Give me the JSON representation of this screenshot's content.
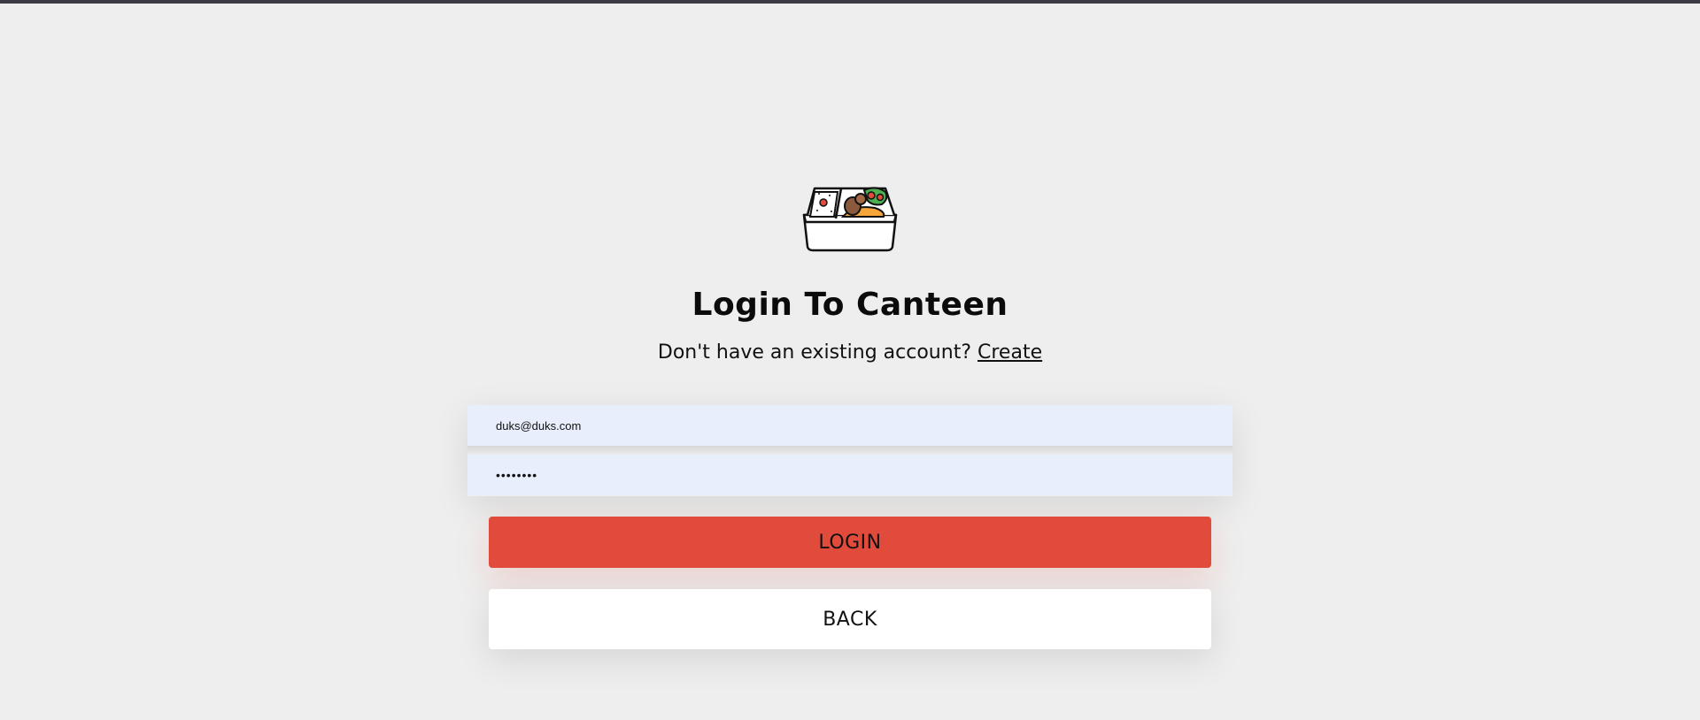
{
  "brand": {
    "logo_icon": "bento-box-icon"
  },
  "auth": {
    "title": "Login To Canteen",
    "subtitle_prefix": "Don't have an existing account?",
    "create_link": "Create"
  },
  "form": {
    "email_value": "duks@duks.com",
    "password_value": "••••••••",
    "login_label": "LOGIN",
    "back_label": "BACK"
  },
  "colors": {
    "background": "#eeeeee",
    "topbar": "#3a3b45",
    "field_bg": "#e8eefb",
    "login_button": "#e14b3c",
    "back_button": "#ffffff"
  }
}
